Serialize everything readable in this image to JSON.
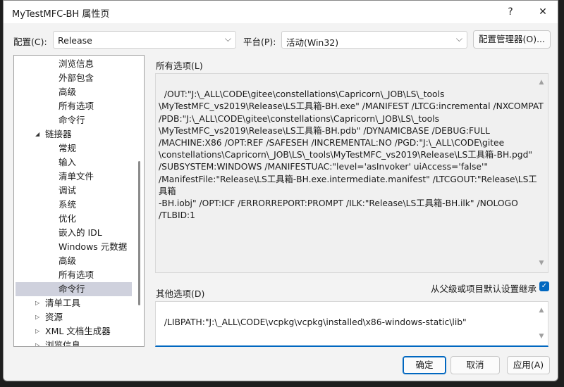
{
  "window": {
    "title": "MyTestMFC-BH 属性页",
    "help": "?",
    "close": "✕"
  },
  "config": {
    "label": "配置(C):",
    "value": "Release"
  },
  "platform": {
    "label": "平台(P):",
    "value": "活动(Win32)"
  },
  "config_manager": "配置管理器(O)...",
  "tree": {
    "items": [
      {
        "label": "浏览信息",
        "level": 2
      },
      {
        "label": "外部包含",
        "level": 2
      },
      {
        "label": "高级",
        "level": 2
      },
      {
        "label": "所有选项",
        "level": 2
      },
      {
        "label": "命令行",
        "level": 2
      },
      {
        "label": "链接器",
        "level": 1,
        "expanded": true
      },
      {
        "label": "常规",
        "level": 2
      },
      {
        "label": "输入",
        "level": 2
      },
      {
        "label": "清单文件",
        "level": 2
      },
      {
        "label": "调试",
        "level": 2
      },
      {
        "label": "系统",
        "level": 2
      },
      {
        "label": "优化",
        "level": 2
      },
      {
        "label": "嵌入的 IDL",
        "level": 2
      },
      {
        "label": "Windows 元数据",
        "level": 2
      },
      {
        "label": "高级",
        "level": 2
      },
      {
        "label": "所有选项",
        "level": 2
      },
      {
        "label": "命令行",
        "level": 2,
        "selected": true
      },
      {
        "label": "清单工具",
        "level": 1,
        "expanded": false
      },
      {
        "label": "资源",
        "level": 1,
        "expanded": false
      },
      {
        "label": "XML 文档生成器",
        "level": 1,
        "expanded": false
      },
      {
        "label": "浏览信息",
        "level": 1,
        "expanded": false
      }
    ]
  },
  "all_options": {
    "label": "所有选项(L)",
    "value": "/OUT:\"J:\\_ALL\\CODE\\gitee\\constellations\\Capricorn\\_JOB\\LS\\_tools\n\\MyTestMFC_vs2019\\Release\\LS工具箱-BH.exe\" /MANIFEST /LTCG:incremental /NXCOMPAT\n/PDB:\"J:\\_ALL\\CODE\\gitee\\constellations\\Capricorn\\_JOB\\LS\\_tools\n\\MyTestMFC_vs2019\\Release\\LS工具箱-BH.pdb\" /DYNAMICBASE /DEBUG:FULL\n/MACHINE:X86 /OPT:REF /SAFESEH /INCREMENTAL:NO /PGD:\"J:\\_ALL\\CODE\\gitee\n\\constellations\\Capricorn\\_JOB\\LS\\_tools\\MyTestMFC_vs2019\\Release\\LS工具箱-BH.pgd\"\n/SUBSYSTEM:WINDOWS /MANIFESTUAC:\"level='asInvoker' uiAccess='false'\"\n/ManifestFile:\"Release\\LS工具箱-BH.exe.intermediate.manifest\" /LTCGOUT:\"Release\\LS工具箱\n-BH.iobj\" /OPT:ICF /ERRORREPORT:PROMPT /ILK:\"Release\\LS工具箱-BH.ilk\" /NOLOGO\n/TLBID:1"
  },
  "other_options": {
    "label": "其他选项(D)",
    "value": "/LIBPATH:\"J:\\_ALL\\CODE\\vcpkg\\vcpkg\\installed\\x86-windows-static\\lib\""
  },
  "inherit": {
    "label": "从父级或项目默认设置继承",
    "checked": true
  },
  "buttons": {
    "ok": "确定",
    "cancel": "取消",
    "apply": "应用(A)"
  },
  "colors": {
    "accent": "#0067c0",
    "selection": "#cfd1dd"
  }
}
